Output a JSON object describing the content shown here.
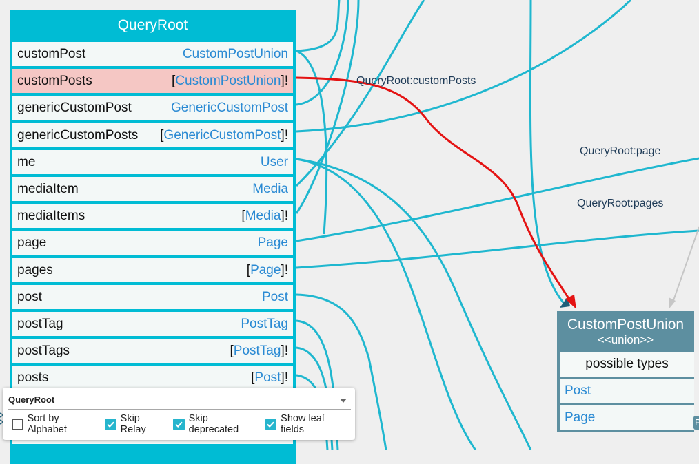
{
  "query_root": {
    "title": "QueryRoot",
    "fields": [
      {
        "name": "customPost",
        "prefix": "",
        "type": "CustomPostUnion",
        "suffix": ""
      },
      {
        "name": "customPosts",
        "prefix": "[",
        "type": "CustomPostUnion",
        "suffix": "]!"
      },
      {
        "name": "genericCustomPost",
        "prefix": "",
        "type": "GenericCustomPost",
        "suffix": ""
      },
      {
        "name": "genericCustomPosts",
        "prefix": "[",
        "type": "GenericCustomPost",
        "suffix": "]!"
      },
      {
        "name": "me",
        "prefix": "",
        "type": "User",
        "suffix": ""
      },
      {
        "name": "mediaItem",
        "prefix": "",
        "type": "Media",
        "suffix": ""
      },
      {
        "name": "mediaItems",
        "prefix": "[",
        "type": "Media",
        "suffix": "]!"
      },
      {
        "name": "page",
        "prefix": "",
        "type": "Page",
        "suffix": ""
      },
      {
        "name": "pages",
        "prefix": "[",
        "type": "Page",
        "suffix": "]!"
      },
      {
        "name": "post",
        "prefix": "",
        "type": "Post",
        "suffix": ""
      },
      {
        "name": "postTag",
        "prefix": "",
        "type": "PostTag",
        "suffix": ""
      },
      {
        "name": "postTags",
        "prefix": "[",
        "type": "PostTag",
        "suffix": "]!"
      },
      {
        "name": "posts",
        "prefix": "[",
        "type": "Post",
        "suffix": "]!"
      }
    ],
    "selected_field": "customPosts"
  },
  "union_node": {
    "title": "CustomPostUnion",
    "subtitle": "<<union>>",
    "section": "possible types",
    "types": [
      "Post",
      "Page"
    ]
  },
  "edge_labels": {
    "custom_posts": "QueryRoot:customPosts",
    "page": "QueryRoot:page",
    "pages": "QueryRoot:pages"
  },
  "side_stub": "P",
  "settings": {
    "root_type": "QueryRoot",
    "options": [
      {
        "label": "Sort by Alphabet",
        "checked": false
      },
      {
        "label": "Skip Relay",
        "checked": true
      },
      {
        "label": "Skip deprecated",
        "checked": true
      },
      {
        "label": "Show leaf fields",
        "checked": true
      }
    ]
  },
  "colors": {
    "node_header": "#00bcd4",
    "union_header": "#5d8fa0",
    "edge": "#1fb7cf",
    "selected_edge": "#e41313",
    "selected_row": "#f5c7c4",
    "type_link": "#2a8ad3"
  }
}
